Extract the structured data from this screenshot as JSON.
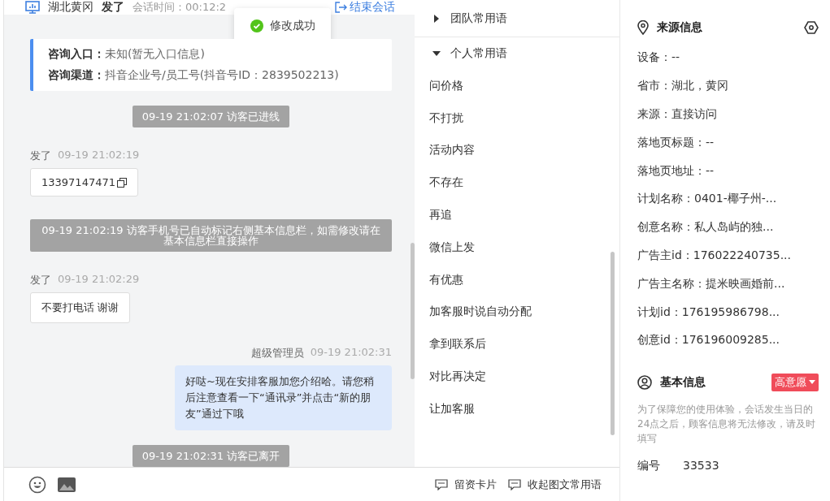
{
  "header": {
    "location": "湖北黄冈",
    "visitor": "发了",
    "session_time": "会话时间：00:12:2",
    "end_button": "结束会话"
  },
  "toast": {
    "text": "修改成功"
  },
  "info_card": {
    "rows": [
      {
        "label": "咨询入口：",
        "value": "未知(暂无入口信息)"
      },
      {
        "label": "咨询渠道：",
        "value": "抖音企业号/员工号(抖音号ID：2839502213)"
      }
    ]
  },
  "messages": [
    {
      "kind": "system",
      "text": "09-19 21:02:07 访客已进线"
    },
    {
      "kind": "visitor",
      "name": "发了",
      "time": "09-19 21:02:19",
      "text": "13397147471",
      "copy": true
    },
    {
      "kind": "system",
      "text": "09-19 21:02:19 访客手机号已自动标记右侧基本信息栏，如需修改请在基本信息栏直接操作"
    },
    {
      "kind": "visitor",
      "name": "发了",
      "time": "09-19 21:02:29",
      "text": "不要打电话 谢谢",
      "copy": false
    },
    {
      "kind": "agent",
      "name": "超级管理员",
      "time": "09-19 21:02:31",
      "text": "好哒~现在安排客服加您介绍哈。请您稍后注意查看一下“通讯录”并点击“新的朋友”通过下哦"
    },
    {
      "kind": "system",
      "text": "09-19 21:02:31 访客已离开"
    }
  ],
  "phrases": {
    "groups": [
      {
        "title": "团队常用语",
        "expanded": false
      },
      {
        "title": "个人常用语",
        "expanded": true
      }
    ],
    "items": [
      "问价格",
      "不打扰",
      "活动内容",
      "不存在",
      "再追",
      "微信上发",
      "有优惠",
      "加客服时说自动分配",
      "拿到联系后",
      "对比再决定",
      "让加客服"
    ]
  },
  "toolbar": {
    "actions": [
      "留资卡片",
      "收起图文常用语"
    ]
  },
  "source_info": {
    "title": "来源信息",
    "fields": [
      "设备：--",
      "省市：湖北，黄冈",
      "来源：直接访问",
      "落地页标题：--",
      "落地页地址：--",
      "计划名称：0401-椰子州-...",
      "创意名称：私人岛屿的独...",
      "广告主id：176022240735...",
      "广告主名称：提米映画婚前...",
      "计划id：176195986798...",
      "创意id：176196009285..."
    ]
  },
  "basic_info": {
    "title": "基本信息",
    "intent": "高意愿",
    "notice": "为了保障您的使用体验，会话发生当日的24点之后，顾客信息将无法修改，请及时填写",
    "number_label": "编号",
    "number_value": "33533"
  }
}
